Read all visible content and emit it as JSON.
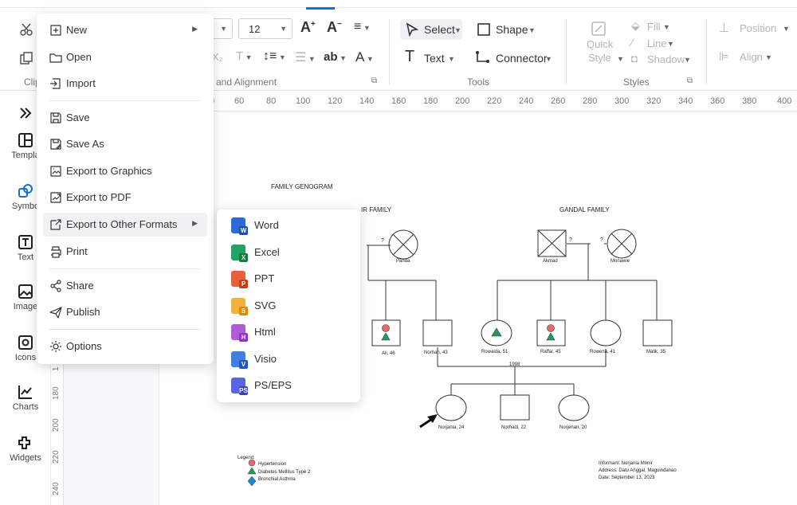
{
  "ribbon": {
    "font_size": "12",
    "select_label": "Select",
    "shape_label": "Shape",
    "text_label": "Text",
    "connector_label": "Connector",
    "quick_style_line1": "Quick",
    "quick_style_line2": "Style",
    "fill_label": "Fill",
    "line_label": "Line",
    "shadow_label": "Shadow",
    "position_label": "Position",
    "align_label": "Align",
    "group_clip": "Clip",
    "group_font": "and Alignment",
    "group_tools": "Tools",
    "group_styles": "Styles"
  },
  "ruler": {
    "h_ticks": [
      "0",
      "60",
      "80",
      "100",
      "120",
      "140",
      "160",
      "180",
      "200",
      "220",
      "240",
      "260",
      "280",
      "300",
      "320",
      "340",
      "360",
      "380",
      "400"
    ],
    "v_ticks": [
      "180",
      "200",
      "220",
      "240"
    ],
    "v_small": "1"
  },
  "sidebar": {
    "items": [
      {
        "label": "",
        "icon": "double-chevron-icon"
      },
      {
        "label": "Templa",
        "icon": "template-icon"
      },
      {
        "label": "Symbo",
        "icon": "symbol-icon"
      },
      {
        "label": "Text",
        "icon": "text-icon"
      },
      {
        "label": "Image",
        "icon": "image-icon"
      },
      {
        "label": "Icons",
        "icon": "icons-icon"
      },
      {
        "label": "Charts",
        "icon": "charts-icon"
      },
      {
        "label": "Widgets",
        "icon": "widgets-icon"
      }
    ]
  },
  "menu": {
    "items": [
      {
        "label": "New",
        "icon": "plus-square-icon",
        "arrow": "▶"
      },
      {
        "label": "Open",
        "icon": "folder-icon"
      },
      {
        "label": "Import",
        "icon": "import-icon"
      },
      {
        "label": "Save",
        "icon": "save-icon"
      },
      {
        "label": "Save As",
        "icon": "save-as-icon"
      },
      {
        "label": "Export to Graphics",
        "icon": "export-graphics-icon"
      },
      {
        "label": "Export to PDF",
        "icon": "export-pdf-icon"
      },
      {
        "label": "Export to Other Formats",
        "icon": "export-other-icon",
        "arrow": "▶"
      },
      {
        "label": "Print",
        "icon": "print-icon"
      },
      {
        "label": "Share",
        "icon": "share-icon"
      },
      {
        "label": "Publish",
        "icon": "publish-icon"
      },
      {
        "label": "Options",
        "icon": "gear-icon"
      }
    ]
  },
  "submenu": {
    "items": [
      {
        "label": "Word",
        "badge": "W",
        "color": "#2b6bd6",
        "badge_color": "#1a4fa8"
      },
      {
        "label": "Excel",
        "badge": "X",
        "color": "#21a366",
        "badge_color": "#107c41"
      },
      {
        "label": "PPT",
        "badge": "P",
        "color": "#e8603c",
        "badge_color": "#c43e1c"
      },
      {
        "label": "SVG",
        "badge": "S",
        "color": "#f3b23f",
        "badge_color": "#e08a00"
      },
      {
        "label": "Html",
        "badge": "H",
        "color": "#b05cd6",
        "badge_color": "#8a36b8"
      },
      {
        "label": "Visio",
        "badge": "V",
        "color": "#3f7fe0",
        "badge_color": "#2455b8"
      },
      {
        "label": "PS/EPS",
        "badge": "PS",
        "color": "#5a66e0",
        "badge_color": "#3a44b8"
      }
    ]
  },
  "diagram": {
    "title": "FAMILY GENOGRAM",
    "family_left": "IR FAMILY",
    "family_right": "GANDAL FAMILY",
    "q_marks": [
      "?",
      "?",
      "?"
    ],
    "marriage_year": "1998",
    "people": {
      "parida": "Parida",
      "akmad": "Akmad",
      "monawie": "Monawie",
      "ali": "Ali, 46",
      "norhan": "Norhan, 43",
      "rowaida": "Rowaida, 51",
      "raffai": "Raffai, 45",
      "rowena": "Rowena, 41",
      "malik": "Malik, 35",
      "norjania": "Norjania, 24",
      "norhadi": "Norhadi, 22",
      "norjehan": "Norjehan, 20"
    },
    "legend": {
      "title": "Legend:",
      "hypertension": "Hypertension",
      "diabetes": "Diabetes Mellitus Type 2",
      "asthma": "Bronchial Asthma"
    },
    "info": {
      "informant": "Informant: Norjania Monir",
      "address": "Address: Datu Anggal, Maguindanao",
      "date": "Date: September 13, 2023"
    },
    "colors": {
      "hypertension": "#e86b6b",
      "diabetes": "#1f9e5a",
      "asthma": "#1e88d6"
    }
  }
}
